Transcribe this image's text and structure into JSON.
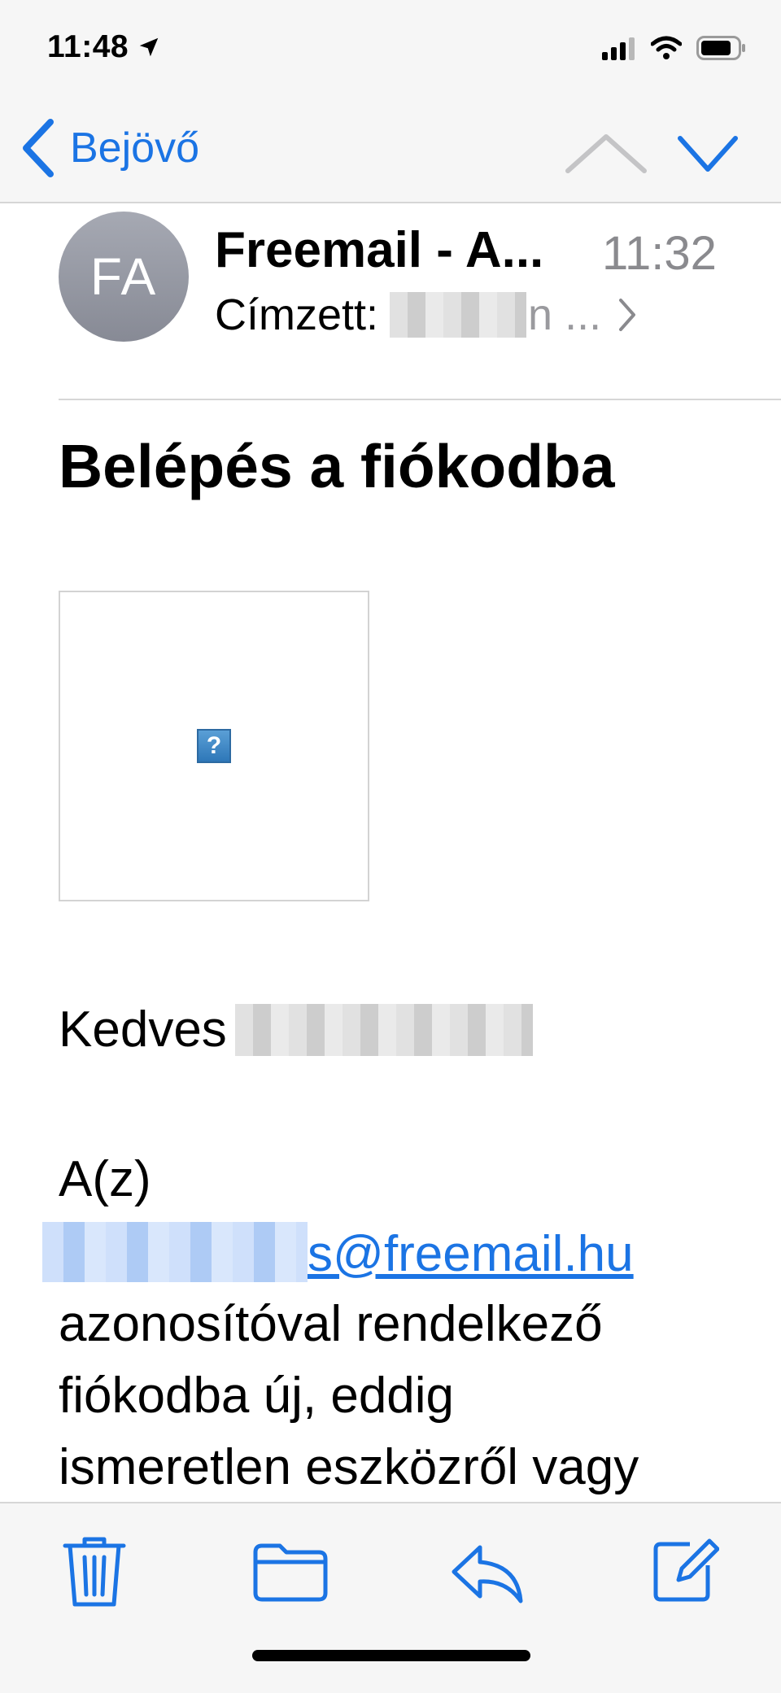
{
  "status_bar": {
    "time": "11:48"
  },
  "nav": {
    "back_label": "Bejövő"
  },
  "header": {
    "avatar_initials": "FA",
    "sender": "Freemail - A...",
    "time": "11:32",
    "recipient_label": "Címzett:",
    "recipient_tail": "n ..."
  },
  "email": {
    "subject": "Belépés a fiókodba",
    "greeting": "Kedves",
    "line1": "A(z)",
    "email_suffix": "s@freemail.hu",
    "line3": "azonosítóval rendelkező",
    "line4": "fiókodba új, eddig",
    "line5": "ismeretlen eszközről vagy",
    "broken_image_glyph": "?"
  },
  "colors": {
    "accent": "#1b74e4",
    "toolbar_bg": "#f6f6f6"
  }
}
